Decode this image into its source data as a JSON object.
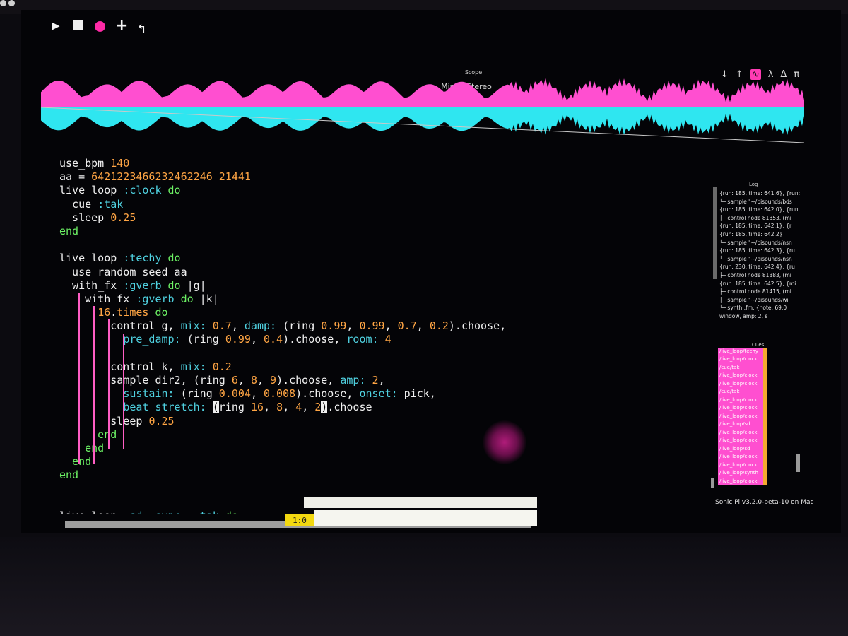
{
  "toolbar": {
    "icons": [
      "play-icon",
      "stop-icon",
      "record-icon",
      "plus-icon",
      "undo-icon",
      "prefs-icon"
    ]
  },
  "scope": {
    "title": "Scope",
    "mode": "Mirror Stereo",
    "tools": [
      "↓",
      "↑",
      "∿",
      "λ",
      "Δ",
      "π"
    ],
    "colors": {
      "left": "#ff4fd0",
      "right": "#2fe6f0"
    }
  },
  "editor": {
    "colors": {
      "keyword": "#6cf064",
      "number": "#ffa544",
      "symbol": "#4fd1e0",
      "text": "#f0f0f0",
      "guide": "#ff5ec4"
    },
    "lines": [
      [
        [
          "w",
          "use_bpm "
        ],
        [
          "n",
          "140"
        ]
      ],
      [
        [
          "w",
          "aa = "
        ],
        [
          "n",
          "6421223466232462246 21441"
        ]
      ],
      [
        [
          "w",
          "live_loop "
        ],
        [
          "s",
          ":clock"
        ],
        [
          "w",
          " "
        ],
        [
          "k",
          "do"
        ]
      ],
      [
        [
          "w",
          "  cue "
        ],
        [
          "s",
          ":tak"
        ]
      ],
      [
        [
          "w",
          "  sleep "
        ],
        [
          "n",
          "0.25"
        ]
      ],
      [
        [
          "k",
          "end"
        ]
      ],
      [],
      [
        [
          "w",
          "live_loop "
        ],
        [
          "s",
          ":techy"
        ],
        [
          "w",
          " "
        ],
        [
          "k",
          "do"
        ]
      ],
      [
        [
          "w",
          "  use_random_seed aa"
        ]
      ],
      [
        [
          "w",
          "  with_fx "
        ],
        [
          "s",
          ":gverb"
        ],
        [
          "w",
          " "
        ],
        [
          "k",
          "do"
        ],
        [
          "w",
          " |g|"
        ]
      ],
      [
        [
          "w",
          "    with_fx "
        ],
        [
          "s",
          ":gverb"
        ],
        [
          "w",
          " "
        ],
        [
          "k",
          "do"
        ],
        [
          "w",
          " |k|"
        ]
      ],
      [
        [
          "w",
          "      "
        ],
        [
          "n",
          "16"
        ],
        [
          "w",
          "."
        ],
        [
          "n",
          "times"
        ],
        [
          "w",
          " "
        ],
        [
          "k",
          "do"
        ]
      ],
      [
        [
          "w",
          "        control g, "
        ],
        [
          "s",
          "mix:"
        ],
        [
          "w",
          " "
        ],
        [
          "n",
          "0.7"
        ],
        [
          "w",
          ", "
        ],
        [
          "s",
          "damp:"
        ],
        [
          "w",
          " (ring "
        ],
        [
          "n",
          "0.99"
        ],
        [
          "w",
          ", "
        ],
        [
          "n",
          "0.99"
        ],
        [
          "w",
          ", "
        ],
        [
          "n",
          "0.7"
        ],
        [
          "w",
          ", "
        ],
        [
          "n",
          "0.2"
        ],
        [
          "w",
          ").choose,"
        ]
      ],
      [
        [
          "w",
          "          "
        ],
        [
          "s",
          "pre_damp:"
        ],
        [
          "w",
          " (ring "
        ],
        [
          "n",
          "0.99"
        ],
        [
          "w",
          ", "
        ],
        [
          "n",
          "0.4"
        ],
        [
          "w",
          ").choose, "
        ],
        [
          "s",
          "room:"
        ],
        [
          "w",
          " "
        ],
        [
          "n",
          "4"
        ]
      ],
      [],
      [
        [
          "w",
          "        control k, "
        ],
        [
          "s",
          "mix:"
        ],
        [
          "w",
          " "
        ],
        [
          "n",
          "0.2"
        ]
      ],
      [
        [
          "w",
          "        sample dir2, (ring "
        ],
        [
          "n",
          "6"
        ],
        [
          "w",
          ", "
        ],
        [
          "n",
          "8"
        ],
        [
          "w",
          ", "
        ],
        [
          "n",
          "9"
        ],
        [
          "w",
          ").choose, "
        ],
        [
          "s",
          "amp:"
        ],
        [
          "w",
          " "
        ],
        [
          "n",
          "2"
        ],
        [
          "w",
          ","
        ]
      ],
      [
        [
          "w",
          "          "
        ],
        [
          "s",
          "sustain:"
        ],
        [
          "w",
          " (ring "
        ],
        [
          "n",
          "0.004"
        ],
        [
          "w",
          ", "
        ],
        [
          "n",
          "0.008"
        ],
        [
          "w",
          ").choose, "
        ],
        [
          "s",
          "onset:"
        ],
        [
          "w",
          " pick,"
        ]
      ],
      [
        [
          "w",
          "          "
        ],
        [
          "s",
          "beat_stretch:"
        ],
        [
          "w",
          " "
        ],
        [
          "c",
          "("
        ],
        [
          "w",
          "ring "
        ],
        [
          "n",
          "16"
        ],
        [
          "w",
          ", "
        ],
        [
          "n",
          "8"
        ],
        [
          "w",
          ", "
        ],
        [
          "n",
          "4"
        ],
        [
          "w",
          ", "
        ],
        [
          "n",
          "2"
        ],
        [
          "c",
          ")"
        ],
        [
          "w",
          ".choose"
        ]
      ],
      [
        [
          "w",
          "        sleep "
        ],
        [
          "n",
          "0.25"
        ]
      ],
      [
        [
          "k",
          "      end"
        ]
      ],
      [
        [
          "k",
          "    end"
        ]
      ],
      [
        [
          "k",
          "  end"
        ]
      ],
      [
        [
          "k",
          "end"
        ]
      ],
      [],
      [],
      [
        [
          "w",
          "live_loop "
        ],
        [
          "s",
          ":sd"
        ],
        [
          "w",
          ", "
        ],
        [
          "s",
          "sync:"
        ],
        [
          "w",
          " "
        ],
        [
          "s",
          ":tak"
        ],
        [
          "w",
          " "
        ],
        [
          "k",
          "do"
        ]
      ]
    ]
  },
  "status": {
    "position": "1:0"
  },
  "log": {
    "title": "Log",
    "lines": [
      "{run: 185, time: 641.6}, {run:",
      " └─ sample \"~/pisounds/bds",
      "{run: 185, time: 642.0}, {run",
      " ├─ control node 81353, (mi",
      "{run: 185, time: 642.1}, {r",
      "{run: 185, time: 642.2}",
      " └─ sample \"~/pisounds/nsn",
      "{run: 185, time: 642.3}, {ru",
      " └─ sample \"~/pisounds/nsn",
      "{run: 230, time: 642.4}, {ru",
      " ├─ control node 81383, (mi",
      "{run: 185, time: 642.5}, {mi",
      " ├─ control node 81415, (mi",
      " ├─ sample \"~/pisounds/wi",
      " └─ synth :fm, {note: 69.0",
      "     window, amp: 2, s"
    ]
  },
  "cues": {
    "title": "Cues",
    "items": [
      "/live_loop/techy",
      "/live_loop/clock",
      "/cue/tak",
      "/live_loop/clock",
      "/live_loop/clock",
      "/cue/tak",
      "/live_loop/clock",
      "/live_loop/clock",
      "/live_loop/clock",
      "/live_loop/sd",
      "/live_loop/clock",
      "/live_loop/clock",
      "/live_loop/sd",
      "/live_loop/clock",
      "/live_loop/clock",
      "/live_loop/synth",
      "/live_loop/clock"
    ]
  },
  "version": "Sonic Pi v3.2.0-beta-10 on Mac"
}
